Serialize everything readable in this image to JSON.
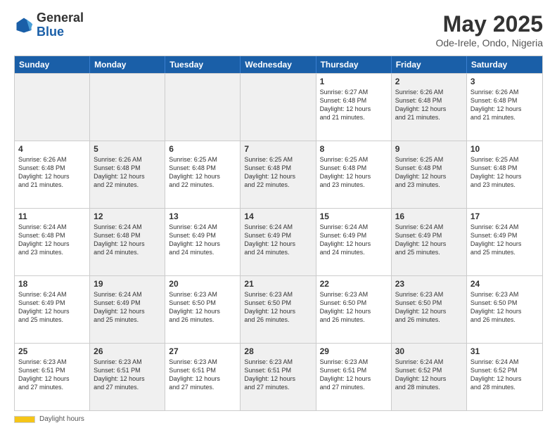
{
  "header": {
    "logo_general": "General",
    "logo_blue": "Blue",
    "month_title": "May 2025",
    "location": "Ode-Irele, Ondo, Nigeria"
  },
  "weekdays": [
    "Sunday",
    "Monday",
    "Tuesday",
    "Wednesday",
    "Thursday",
    "Friday",
    "Saturday"
  ],
  "footer": {
    "daylight_label": "Daylight hours"
  },
  "weeks": [
    [
      {
        "day": "",
        "info": "",
        "shaded": true
      },
      {
        "day": "",
        "info": "",
        "shaded": true
      },
      {
        "day": "",
        "info": "",
        "shaded": true
      },
      {
        "day": "",
        "info": "",
        "shaded": true
      },
      {
        "day": "1",
        "info": "Sunrise: 6:27 AM\nSunset: 6:48 PM\nDaylight: 12 hours\nand 21 minutes.",
        "shaded": false
      },
      {
        "day": "2",
        "info": "Sunrise: 6:26 AM\nSunset: 6:48 PM\nDaylight: 12 hours\nand 21 minutes.",
        "shaded": true
      },
      {
        "day": "3",
        "info": "Sunrise: 6:26 AM\nSunset: 6:48 PM\nDaylight: 12 hours\nand 21 minutes.",
        "shaded": false
      }
    ],
    [
      {
        "day": "4",
        "info": "Sunrise: 6:26 AM\nSunset: 6:48 PM\nDaylight: 12 hours\nand 21 minutes.",
        "shaded": false
      },
      {
        "day": "5",
        "info": "Sunrise: 6:26 AM\nSunset: 6:48 PM\nDaylight: 12 hours\nand 22 minutes.",
        "shaded": true
      },
      {
        "day": "6",
        "info": "Sunrise: 6:25 AM\nSunset: 6:48 PM\nDaylight: 12 hours\nand 22 minutes.",
        "shaded": false
      },
      {
        "day": "7",
        "info": "Sunrise: 6:25 AM\nSunset: 6:48 PM\nDaylight: 12 hours\nand 22 minutes.",
        "shaded": true
      },
      {
        "day": "8",
        "info": "Sunrise: 6:25 AM\nSunset: 6:48 PM\nDaylight: 12 hours\nand 23 minutes.",
        "shaded": false
      },
      {
        "day": "9",
        "info": "Sunrise: 6:25 AM\nSunset: 6:48 PM\nDaylight: 12 hours\nand 23 minutes.",
        "shaded": true
      },
      {
        "day": "10",
        "info": "Sunrise: 6:25 AM\nSunset: 6:48 PM\nDaylight: 12 hours\nand 23 minutes.",
        "shaded": false
      }
    ],
    [
      {
        "day": "11",
        "info": "Sunrise: 6:24 AM\nSunset: 6:48 PM\nDaylight: 12 hours\nand 23 minutes.",
        "shaded": false
      },
      {
        "day": "12",
        "info": "Sunrise: 6:24 AM\nSunset: 6:48 PM\nDaylight: 12 hours\nand 24 minutes.",
        "shaded": true
      },
      {
        "day": "13",
        "info": "Sunrise: 6:24 AM\nSunset: 6:49 PM\nDaylight: 12 hours\nand 24 minutes.",
        "shaded": false
      },
      {
        "day": "14",
        "info": "Sunrise: 6:24 AM\nSunset: 6:49 PM\nDaylight: 12 hours\nand 24 minutes.",
        "shaded": true
      },
      {
        "day": "15",
        "info": "Sunrise: 6:24 AM\nSunset: 6:49 PM\nDaylight: 12 hours\nand 24 minutes.",
        "shaded": false
      },
      {
        "day": "16",
        "info": "Sunrise: 6:24 AM\nSunset: 6:49 PM\nDaylight: 12 hours\nand 25 minutes.",
        "shaded": true
      },
      {
        "day": "17",
        "info": "Sunrise: 6:24 AM\nSunset: 6:49 PM\nDaylight: 12 hours\nand 25 minutes.",
        "shaded": false
      }
    ],
    [
      {
        "day": "18",
        "info": "Sunrise: 6:24 AM\nSunset: 6:49 PM\nDaylight: 12 hours\nand 25 minutes.",
        "shaded": false
      },
      {
        "day": "19",
        "info": "Sunrise: 6:24 AM\nSunset: 6:49 PM\nDaylight: 12 hours\nand 25 minutes.",
        "shaded": true
      },
      {
        "day": "20",
        "info": "Sunrise: 6:23 AM\nSunset: 6:50 PM\nDaylight: 12 hours\nand 26 minutes.",
        "shaded": false
      },
      {
        "day": "21",
        "info": "Sunrise: 6:23 AM\nSunset: 6:50 PM\nDaylight: 12 hours\nand 26 minutes.",
        "shaded": true
      },
      {
        "day": "22",
        "info": "Sunrise: 6:23 AM\nSunset: 6:50 PM\nDaylight: 12 hours\nand 26 minutes.",
        "shaded": false
      },
      {
        "day": "23",
        "info": "Sunrise: 6:23 AM\nSunset: 6:50 PM\nDaylight: 12 hours\nand 26 minutes.",
        "shaded": true
      },
      {
        "day": "24",
        "info": "Sunrise: 6:23 AM\nSunset: 6:50 PM\nDaylight: 12 hours\nand 26 minutes.",
        "shaded": false
      }
    ],
    [
      {
        "day": "25",
        "info": "Sunrise: 6:23 AM\nSunset: 6:51 PM\nDaylight: 12 hours\nand 27 minutes.",
        "shaded": false
      },
      {
        "day": "26",
        "info": "Sunrise: 6:23 AM\nSunset: 6:51 PM\nDaylight: 12 hours\nand 27 minutes.",
        "shaded": true
      },
      {
        "day": "27",
        "info": "Sunrise: 6:23 AM\nSunset: 6:51 PM\nDaylight: 12 hours\nand 27 minutes.",
        "shaded": false
      },
      {
        "day": "28",
        "info": "Sunrise: 6:23 AM\nSunset: 6:51 PM\nDaylight: 12 hours\nand 27 minutes.",
        "shaded": true
      },
      {
        "day": "29",
        "info": "Sunrise: 6:23 AM\nSunset: 6:51 PM\nDaylight: 12 hours\nand 27 minutes.",
        "shaded": false
      },
      {
        "day": "30",
        "info": "Sunrise: 6:24 AM\nSunset: 6:52 PM\nDaylight: 12 hours\nand 28 minutes.",
        "shaded": true
      },
      {
        "day": "31",
        "info": "Sunrise: 6:24 AM\nSunset: 6:52 PM\nDaylight: 12 hours\nand 28 minutes.",
        "shaded": false
      }
    ]
  ]
}
